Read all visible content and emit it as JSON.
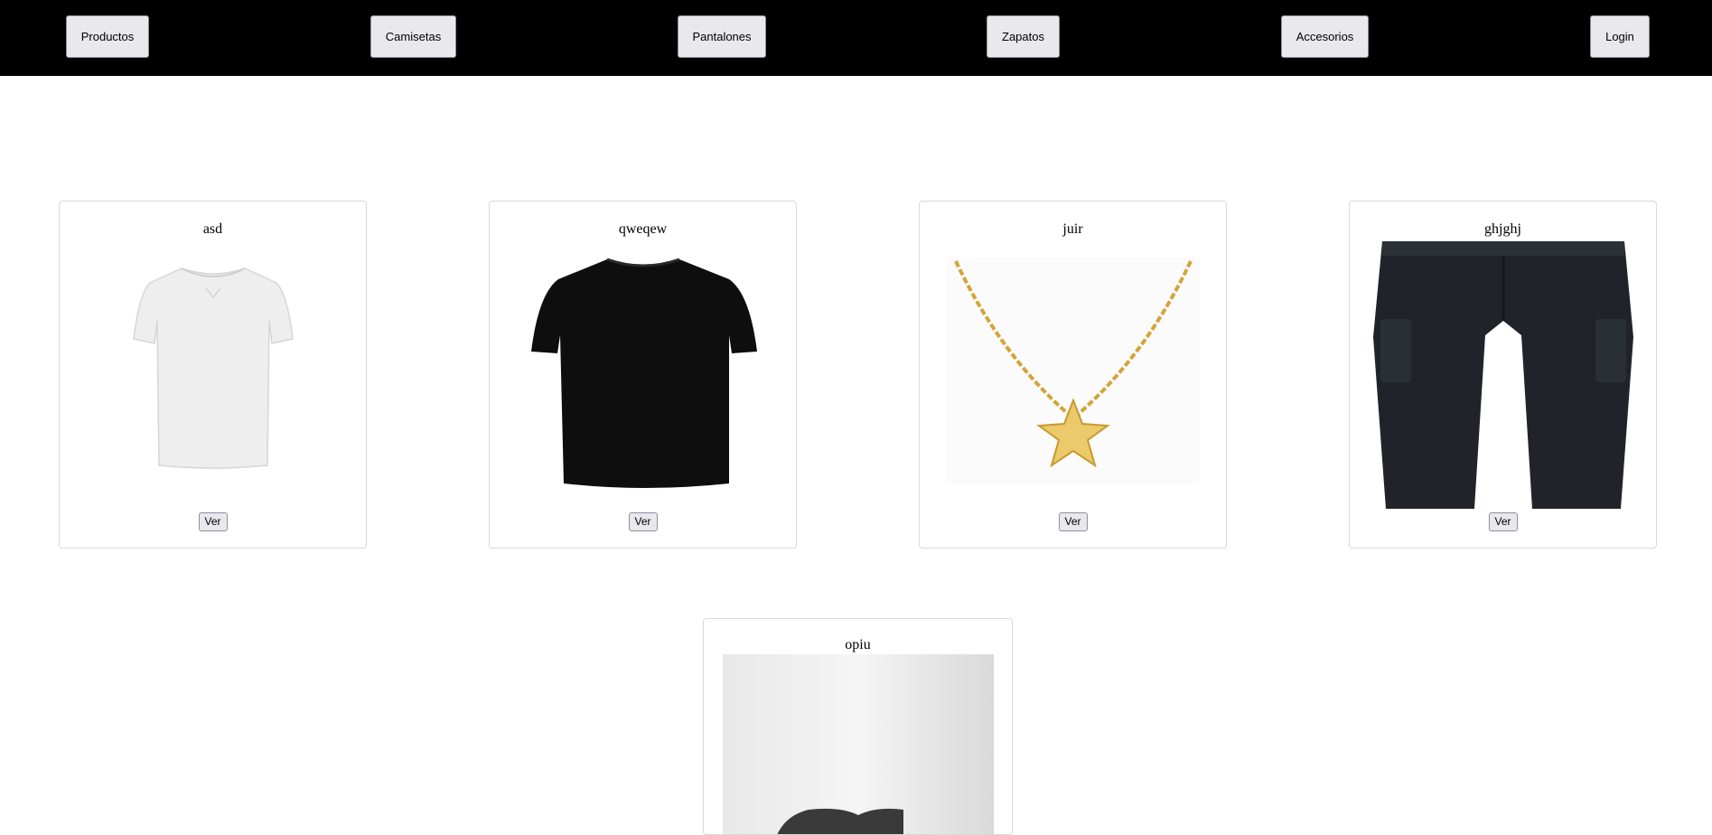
{
  "nav": {
    "items": [
      {
        "label": "Productos"
      },
      {
        "label": "Camisetas"
      },
      {
        "label": "Pantalones"
      },
      {
        "label": "Zapatos"
      },
      {
        "label": "Accesorios"
      }
    ],
    "login_label": "Login"
  },
  "products": [
    {
      "name": "asd",
      "image": "white-tshirt-image",
      "button": "Ver"
    },
    {
      "name": "qweqew",
      "image": "black-tshirt-image",
      "button": "Ver"
    },
    {
      "name": "juir",
      "image": "gold-star-necklace-image",
      "button": "Ver"
    },
    {
      "name": "ghjghj",
      "image": "black-cargo-pants-image",
      "button": "Ver"
    },
    {
      "name": "opiu",
      "image": "shoe-image"
    }
  ],
  "colors": {
    "topbar": "#000000",
    "button_bg": "#e9e9ed",
    "card_border": "#d9d9d9"
  }
}
